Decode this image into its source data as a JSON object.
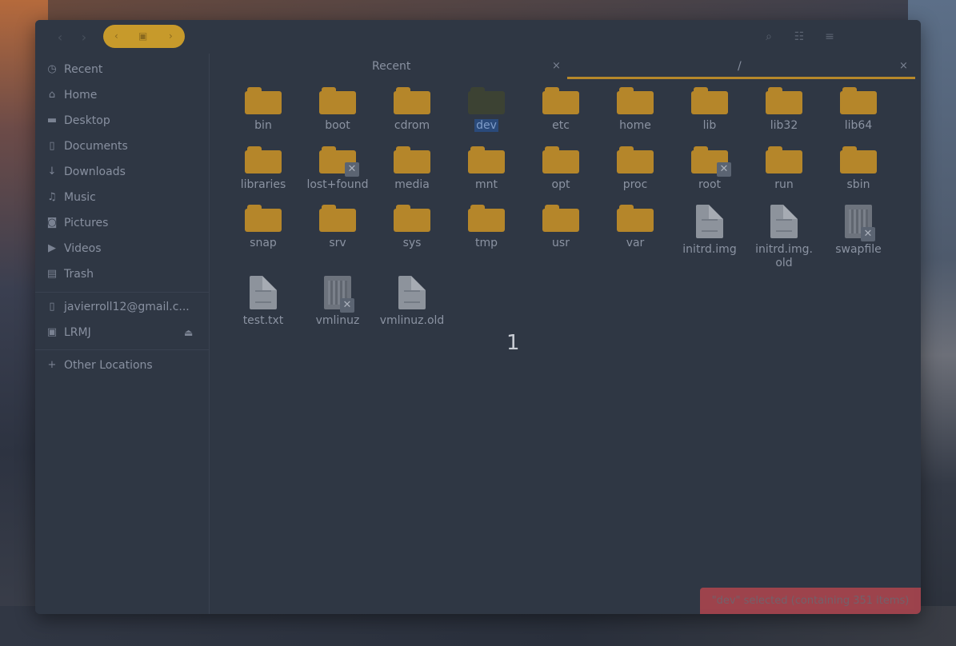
{
  "sidebar": {
    "items": [
      {
        "label": "Recent",
        "icon": "clock-icon"
      },
      {
        "label": "Home",
        "icon": "home-icon"
      },
      {
        "label": "Desktop",
        "icon": "folder-icon"
      },
      {
        "label": "Documents",
        "icon": "document-icon"
      },
      {
        "label": "Downloads",
        "icon": "download-icon"
      },
      {
        "label": "Music",
        "icon": "music-icon"
      },
      {
        "label": "Pictures",
        "icon": "camera-icon"
      },
      {
        "label": "Videos",
        "icon": "video-icon"
      },
      {
        "label": "Trash",
        "icon": "trash-icon"
      }
    ],
    "devices": [
      {
        "label": "javierroll12@gmail.c...",
        "icon": "phone-icon"
      },
      {
        "label": "LRMJ",
        "icon": "drive-icon"
      }
    ],
    "other": {
      "label": "Other Locations",
      "icon": "plus-icon"
    }
  },
  "tabs": [
    {
      "label": "Recent",
      "close": "×"
    },
    {
      "label": "/",
      "close": "×"
    }
  ],
  "files": {
    "row1": [
      "bin",
      "boot",
      "cdrom",
      "dev",
      "etc",
      "home",
      "lib",
      "lib32",
      "lib64"
    ],
    "row2": [
      "libraries",
      "lost+found",
      "media",
      "mnt",
      "opt",
      "proc",
      "root",
      "run",
      "sbin"
    ],
    "row3": [
      "snap",
      "srv",
      "sys",
      "tmp",
      "usr",
      "var",
      "initrd.img",
      "initrd.img.\nold",
      "swapfile"
    ],
    "row4": [
      "test.txt",
      "vmlinuz",
      "vmlinuz.old"
    ]
  },
  "overlay_number": "1",
  "status": "\"dev\" selected  (containing 351 items)"
}
